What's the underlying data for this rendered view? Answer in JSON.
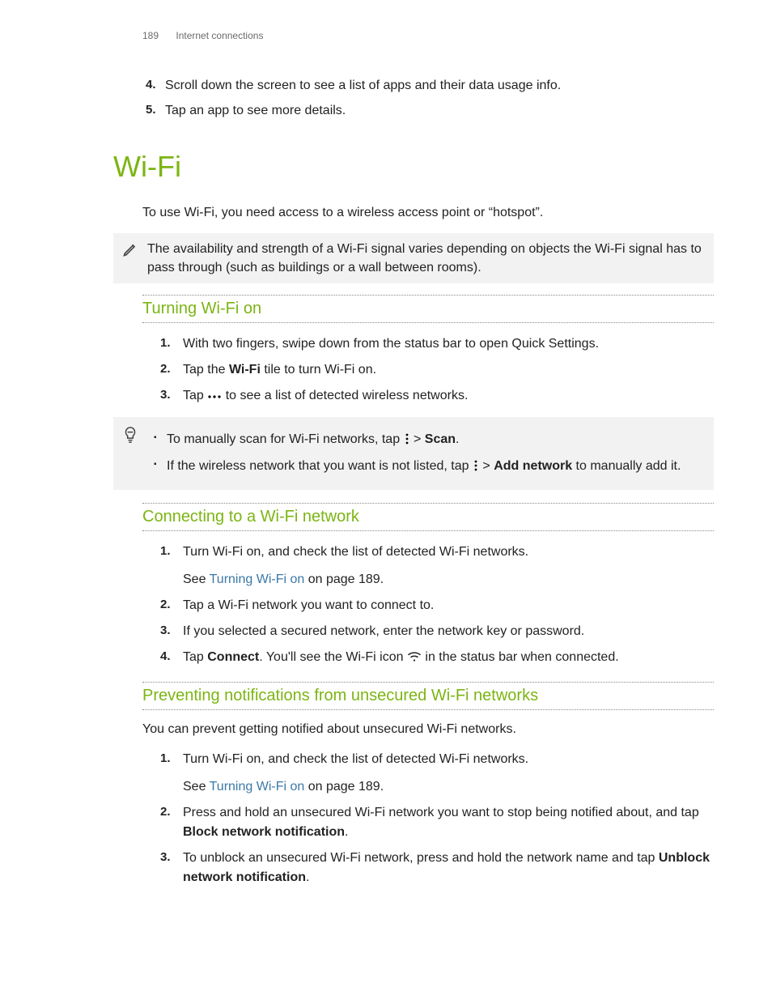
{
  "header": {
    "page_number": "189",
    "section": "Internet connections"
  },
  "carryover_steps": {
    "step4": "Scroll down the screen to see a list of apps and their data usage info.",
    "step5": "Tap an app to see more details."
  },
  "h1": "Wi-Fi",
  "intro": "To use Wi-Fi, you need access to a wireless access point or “hotspot”.",
  "note_text": "The availability and strength of a Wi-Fi signal varies depending on objects the Wi-Fi signal has to pass through (such as buildings or a wall between rooms).",
  "sec1": {
    "title": "Turning Wi-Fi on",
    "s1": "With two fingers, swipe down from the status bar to open Quick Settings.",
    "s2_a": "Tap the ",
    "s2_b": "Wi-Fi",
    "s2_c": " tile to turn Wi-Fi on.",
    "s3_a": "Tap ",
    "s3_b": " to see a list of detected wireless networks."
  },
  "tip": {
    "b1_a": "To manually scan for Wi-Fi networks, tap ",
    "b1_b": " > ",
    "b1_c": "Scan",
    "b1_d": ".",
    "b2_a": "If the wireless network that you want is not listed, tap ",
    "b2_b": " > ",
    "b2_c": "Add network",
    "b2_d": " to manually add it."
  },
  "sec2": {
    "title": "Connecting to a Wi-Fi network",
    "s1_a": "Turn Wi-Fi on, and check the list of detected Wi-Fi networks.",
    "s1_b": "See ",
    "s1_link": "Turning Wi-Fi on",
    "s1_c": " on page 189.",
    "s2": "Tap a Wi-Fi network you want to connect to.",
    "s3": "If you selected a secured network, enter the network key or password.",
    "s4_a": "Tap ",
    "s4_b": "Connect",
    "s4_c": ". You'll see the Wi-Fi icon ",
    "s4_d": " in the status bar when connected."
  },
  "sec3": {
    "title": "Preventing notifications from unsecured Wi-Fi networks",
    "p": "You can prevent getting notified about unsecured Wi-Fi networks.",
    "s1_a": "Turn Wi-Fi on, and check the list of detected Wi-Fi networks.",
    "s1_b": "See ",
    "s1_link": "Turning Wi-Fi on",
    "s1_c": " on page 189.",
    "s2_a": "Press and hold an unsecured Wi-Fi network you want to stop being notified about, and tap ",
    "s2_b": "Block network notification",
    "s2_d": ".",
    "s3_a": "To unblock an unsecured Wi-Fi network, press and hold the network name and tap ",
    "s3_b": "Unblock network notification",
    "s3_d": "."
  }
}
